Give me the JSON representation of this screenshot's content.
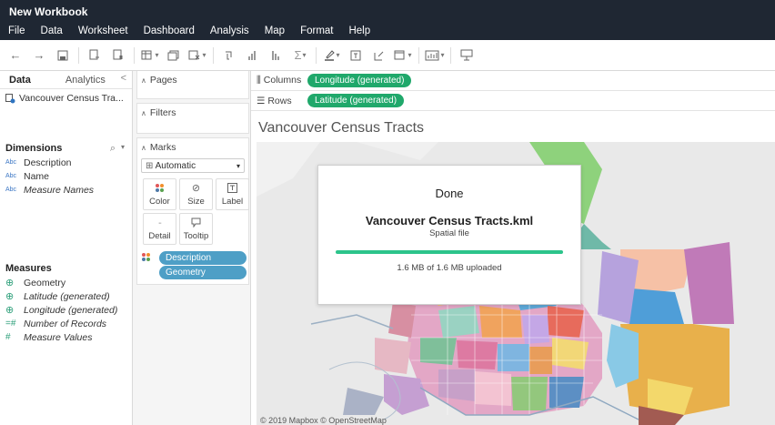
{
  "workbook_title": "New Workbook",
  "menu": [
    "File",
    "Data",
    "Worksheet",
    "Dashboard",
    "Analysis",
    "Map",
    "Format",
    "Help"
  ],
  "toolbar": {
    "icons": [
      "back-arrow-icon",
      "forward-arrow-icon",
      "save-icon",
      "new-data-source-icon",
      "pause-updates-icon",
      "new-worksheet-icon",
      "duplicate-sheet-icon",
      "clear-sheet-icon",
      "swap-icon",
      "sort-ascending-icon",
      "sort-descending-icon",
      "totals-icon",
      "highlight-icon",
      "labels-icon",
      "annotate-icon",
      "fit-icon",
      "show-me-icon",
      "presentation-icon"
    ]
  },
  "data_pane": {
    "tab_data": "Data",
    "tab_analytics": "Analytics",
    "tab_collapse": "<",
    "data_source": "Vancouver Census Tra...",
    "dimensions_header": "Dimensions",
    "dimensions": [
      {
        "type": "Abc",
        "name": "Description",
        "italic": false
      },
      {
        "type": "Abc",
        "name": "Name",
        "italic": false
      },
      {
        "type": "Abc",
        "name": "Measure Names",
        "italic": true
      }
    ],
    "measures_header": "Measures",
    "measures": [
      {
        "type": "globe",
        "name": "Geometry",
        "italic": false
      },
      {
        "type": "globe",
        "name": "Latitude (generated)",
        "italic": true
      },
      {
        "type": "globe",
        "name": "Longitude (generated)",
        "italic": true
      },
      {
        "type": "=#",
        "name": "Number of Records",
        "italic": true
      },
      {
        "type": "#",
        "name": "Measure Values",
        "italic": true
      }
    ]
  },
  "shelves": {
    "pages_label": "Pages",
    "filters_label": "Filters",
    "marks_label": "Marks",
    "mark_type": "Automatic",
    "mark_buttons": [
      "Color",
      "Size",
      "Label",
      "Detail",
      "Tooltip"
    ],
    "mark_pills": [
      "Description",
      "Geometry"
    ],
    "columns_label": "Columns",
    "columns_pill": "Longitude (generated)",
    "rows_label": "Rows",
    "rows_pill": "Latitude (generated)"
  },
  "viz": {
    "title": "Vancouver Census Tracts",
    "attribution": "© 2019 Mapbox © OpenStreetMap"
  },
  "upload_dialog": {
    "title": "Done",
    "file_name": "Vancouver Census Tracts.kml",
    "file_type": "Spatial file",
    "progress_fraction": 1.0,
    "status": "1.6 MB of 1.6 MB uploaded",
    "accent_color": "#2cc48b"
  },
  "colors": {
    "titlebar": "#1f2733",
    "pill_green": "#20a86b",
    "pill_blue": "#4e9fc6"
  }
}
